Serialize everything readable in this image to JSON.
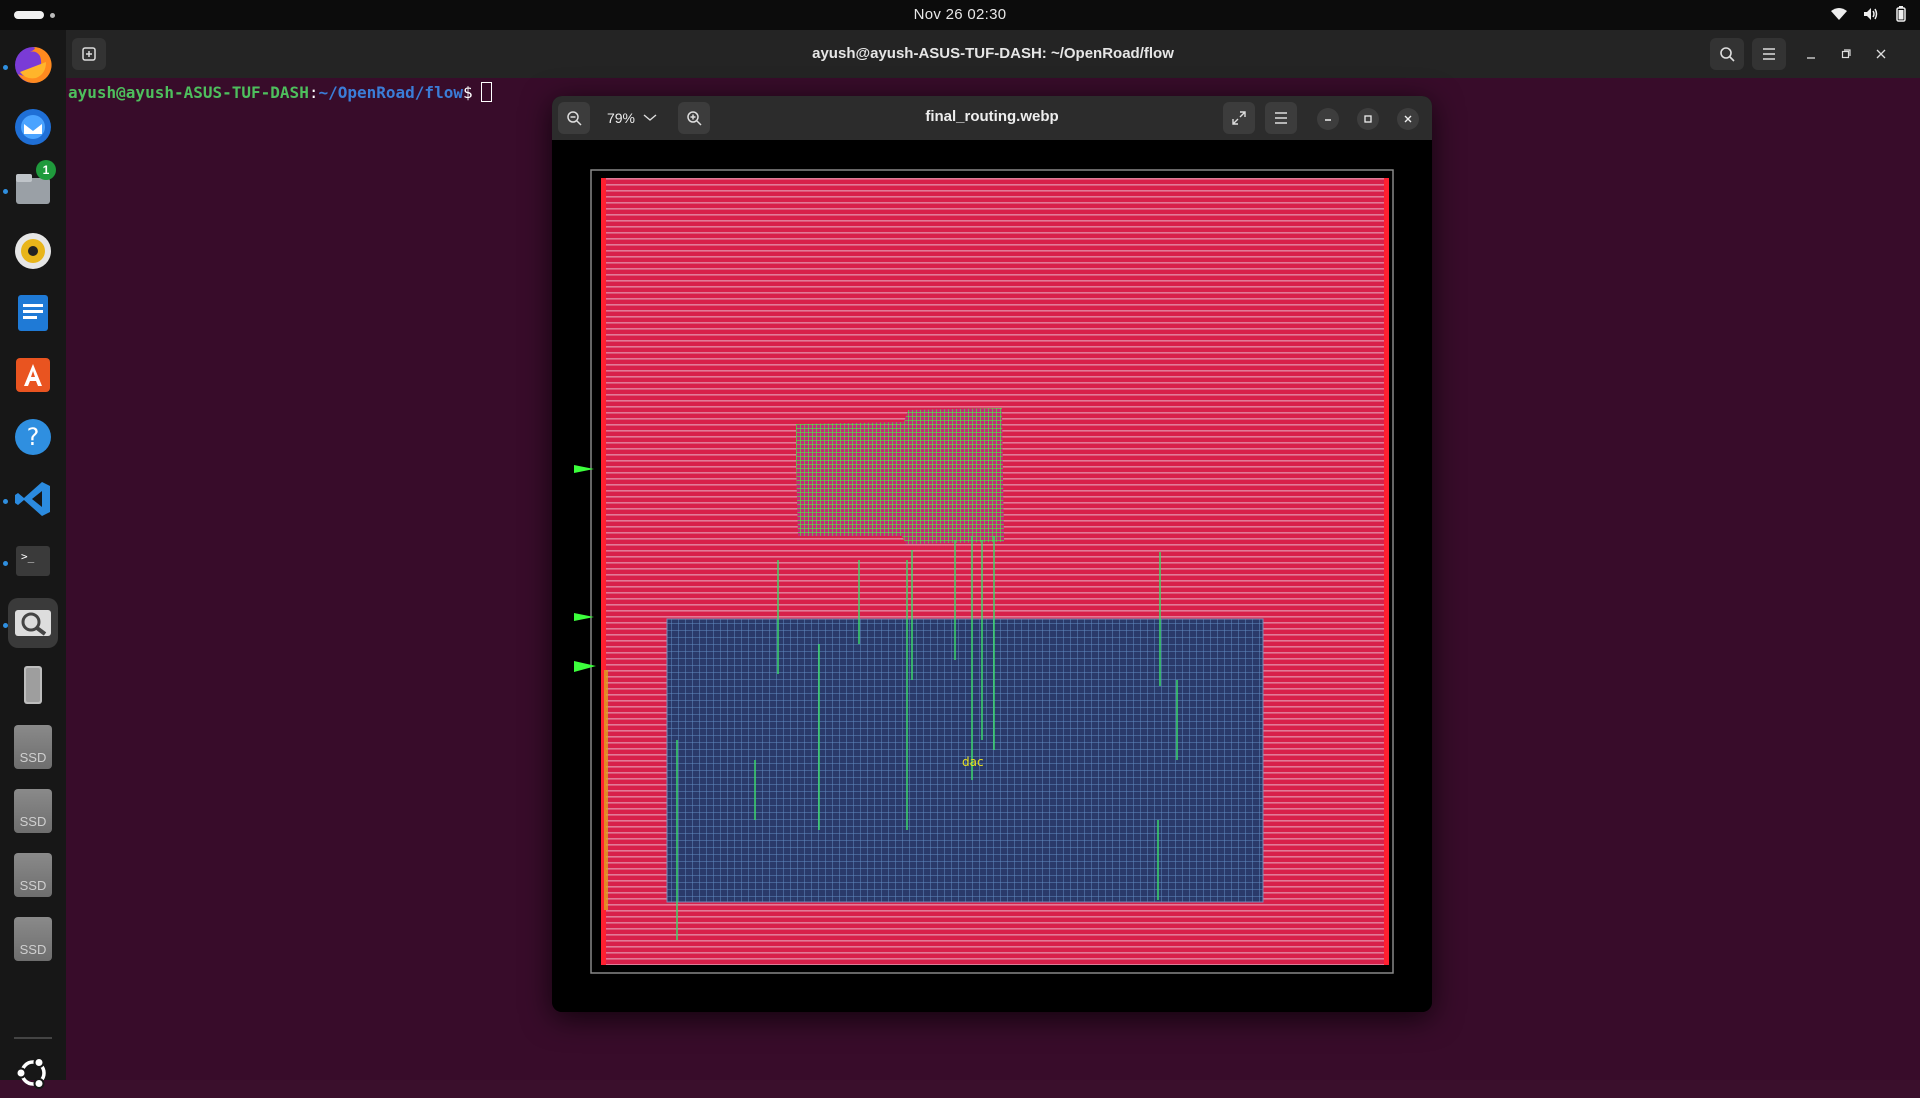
{
  "topbar": {
    "clock": "Nov 26  02:30",
    "icons": [
      "wifi-icon",
      "volume-icon",
      "battery-icon"
    ]
  },
  "dock": {
    "apps": [
      {
        "name": "firefox",
        "running": true
      },
      {
        "name": "thunderbird",
        "running": false
      },
      {
        "name": "files",
        "running": true,
        "badge": "1"
      },
      {
        "name": "rhythmbox",
        "running": false
      },
      {
        "name": "libreoffice-writer",
        "running": false
      },
      {
        "name": "app-center",
        "running": false
      },
      {
        "name": "help",
        "running": false
      },
      {
        "name": "vscode",
        "running": true
      },
      {
        "name": "terminal",
        "running": true
      },
      {
        "name": "image-viewer",
        "running": true,
        "active": true
      },
      {
        "name": "usb-drive",
        "running": false
      },
      {
        "name": "ssd-1",
        "label": "SSD"
      },
      {
        "name": "ssd-2",
        "label": "SSD"
      },
      {
        "name": "ssd-3",
        "label": "SSD"
      },
      {
        "name": "ssd-4",
        "label": "SSD"
      },
      {
        "name": "show-apps"
      }
    ]
  },
  "terminal": {
    "title": "ayush@ayush-ASUS-TUF-DASH: ~/OpenRoad/flow",
    "prompt_user": "ayush@ayush-ASUS-TUF-DASH",
    "prompt_sep": ":",
    "prompt_path": "~/OpenRoad/flow",
    "prompt_symbol": "$"
  },
  "viewer": {
    "title": "final_routing.webp",
    "zoom": "79%",
    "macro_label": "dac"
  },
  "colors": {
    "desktop_bg": "#380c2a",
    "prompt_user": "#4ebf5d",
    "prompt_path": "#3b7dd8",
    "layout_bg": "#d8204a",
    "macro_bg": "#2a3a6a",
    "route_green": "#3cff3c"
  }
}
